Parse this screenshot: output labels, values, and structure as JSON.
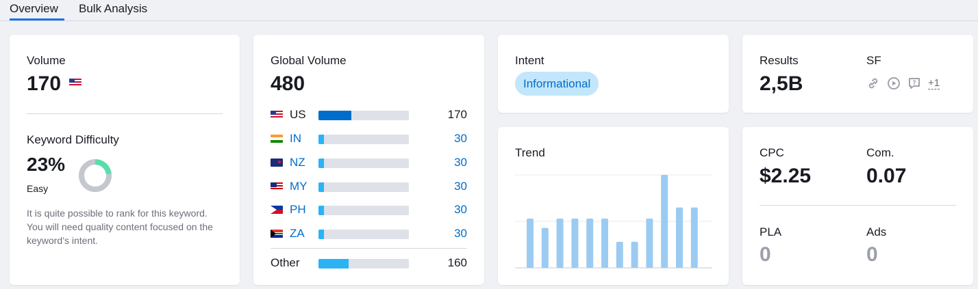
{
  "tabs": [
    {
      "label": "Overview",
      "active": true
    },
    {
      "label": "Bulk Analysis",
      "active": false
    }
  ],
  "volume": {
    "label": "Volume",
    "value": "170",
    "flag": "us-flag-icon"
  },
  "keyword_difficulty": {
    "label": "Keyword Difficulty",
    "value": "23%",
    "level": "Easy",
    "percent": 23,
    "ring_color": "#59ddaa",
    "ring_bg": "#c4c7cf",
    "description": "It is quite possible to rank for this keyword. You will need quality content focused on the keyword’s intent."
  },
  "global_volume": {
    "label": "Global Volume",
    "value": "480",
    "rows": [
      {
        "code": "US",
        "flag": "us-flag-icon",
        "value": "170",
        "fraction": 0.36,
        "link": false
      },
      {
        "code": "IN",
        "flag": "in-flag-icon",
        "value": "30",
        "fraction": 0.06,
        "link": true
      },
      {
        "code": "NZ",
        "flag": "nz-flag-icon",
        "value": "30",
        "fraction": 0.06,
        "link": true
      },
      {
        "code": "MY",
        "flag": "my-flag-icon",
        "value": "30",
        "fraction": 0.06,
        "link": true
      },
      {
        "code": "PH",
        "flag": "ph-flag-icon",
        "value": "30",
        "fraction": 0.06,
        "link": true
      },
      {
        "code": "ZA",
        "flag": "za-flag-icon",
        "value": "30",
        "fraction": 0.06,
        "link": true
      }
    ],
    "other": {
      "label": "Other",
      "value": "160",
      "fraction": 0.33
    }
  },
  "intent": {
    "label": "Intent",
    "tag": "Informational"
  },
  "trend": {
    "label": "Trend",
    "values": [
      0.53,
      0.43,
      0.53,
      0.53,
      0.53,
      0.53,
      0.28,
      0.28,
      0.53,
      1.0,
      0.65,
      0.65
    ],
    "bar_color": "#9ccbf2"
  },
  "results": {
    "label": "Results",
    "value": "2,5B",
    "sf_label": "SF",
    "sf_icons": [
      "link-icon",
      "video-icon",
      "faq-icon"
    ],
    "sf_more": "+1"
  },
  "metrics": {
    "cpc_label": "CPC",
    "cpc_value": "$2.25",
    "com_label": "Com.",
    "com_value": "0.07",
    "pla_label": "PLA",
    "pla_value": "0",
    "ads_label": "Ads",
    "ads_value": "0"
  },
  "colors": {
    "accent": "#006dca",
    "tab_underline": "#1a73e8",
    "bar_light": "#2bb3f5",
    "bar_dark": "#006dca"
  }
}
